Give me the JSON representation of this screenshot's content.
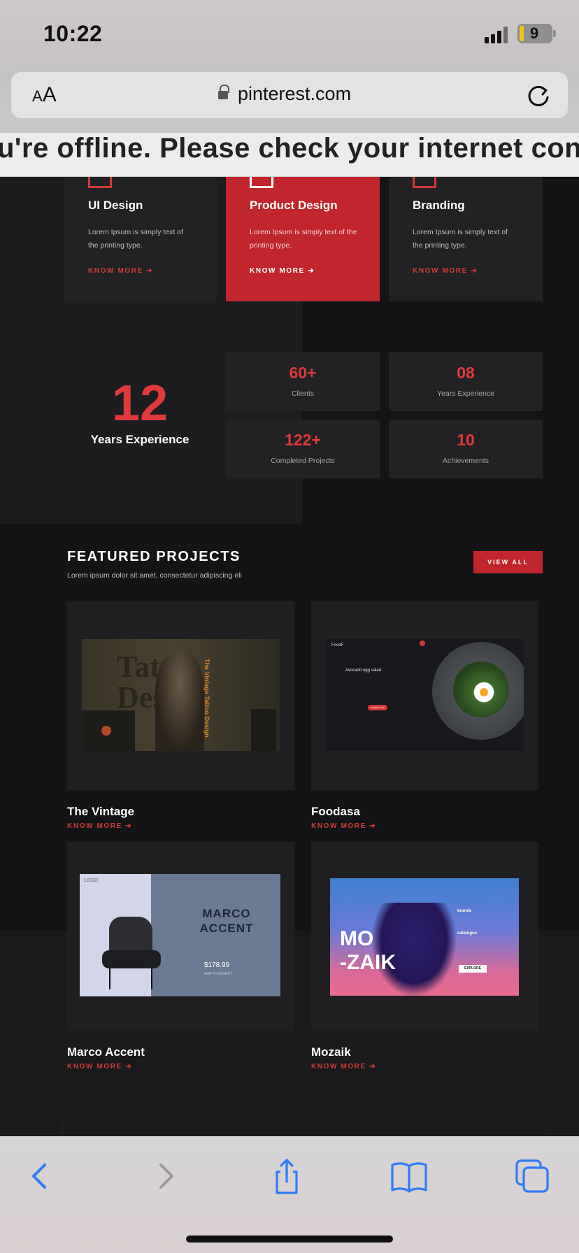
{
  "status": {
    "time": "10:22",
    "battery": "9"
  },
  "browser": {
    "aa_small": "A",
    "aa_large": "A",
    "url": "pinterest.com",
    "offline_message": "u're offline. Please check your internet conn"
  },
  "services": [
    {
      "title": "UI Design",
      "desc": "Lorem Ipsum is simply text of the printing type.",
      "link": "KNOW MORE",
      "icon": "ui-design-icon"
    },
    {
      "title": "Product Design",
      "desc": "Lorem Ipsum is simply text of the printing type.",
      "link": "KNOW MORE",
      "icon": "product-design-icon"
    },
    {
      "title": "Branding",
      "desc": "Lorem Ipsum is simply text of the printing type.",
      "link": "KNOW MORE",
      "icon": "branding-icon"
    }
  ],
  "experience": {
    "number": "12",
    "label": "Years Experience"
  },
  "stats": [
    {
      "value": "60+",
      "label": "Clients"
    },
    {
      "value": "08",
      "label": "Years Experience"
    },
    {
      "value": "122+",
      "label": "Completed Projects"
    },
    {
      "value": "10",
      "label": "Achievements"
    }
  ],
  "featured": {
    "title": "FEATURED PROJECTS",
    "subtitle": "Lorem ipsum dolor sit amet, consectetur adipiscing eli",
    "view_all": "VIEW ALL",
    "projects": [
      {
        "title": "The Vintage",
        "link": "KNOW MORE"
      },
      {
        "title": "Foodasa",
        "link": "KNOW MORE"
      },
      {
        "title": "Marco Accent",
        "link": "KNOW MORE"
      },
      {
        "title": "Mozaik",
        "link": "KNOW MORE"
      }
    ],
    "previews": {
      "vintage": {
        "bg_text": "Tattoo Design",
        "side_text": "The Vintage Tattoo Design"
      },
      "foodasa": {
        "logo": "FoodF",
        "heading": "Avocado egg salad",
        "button": "ORDER NOW"
      },
      "marco": {
        "logo": "LOGO",
        "name_line1": "MARCO",
        "name_line2": "ACCENT",
        "price": "$178.99",
        "cta": "ADD TO BASKET"
      },
      "mozaik": {
        "line1": "MO",
        "line2": "-ZAIK",
        "brands": "brands",
        "catalogue": "catalogue",
        "explore": "EXPLORE"
      }
    }
  },
  "colors": {
    "accent": "#c0262b",
    "accent_text": "#e0393b",
    "background": "#141416",
    "card": "#222225"
  }
}
